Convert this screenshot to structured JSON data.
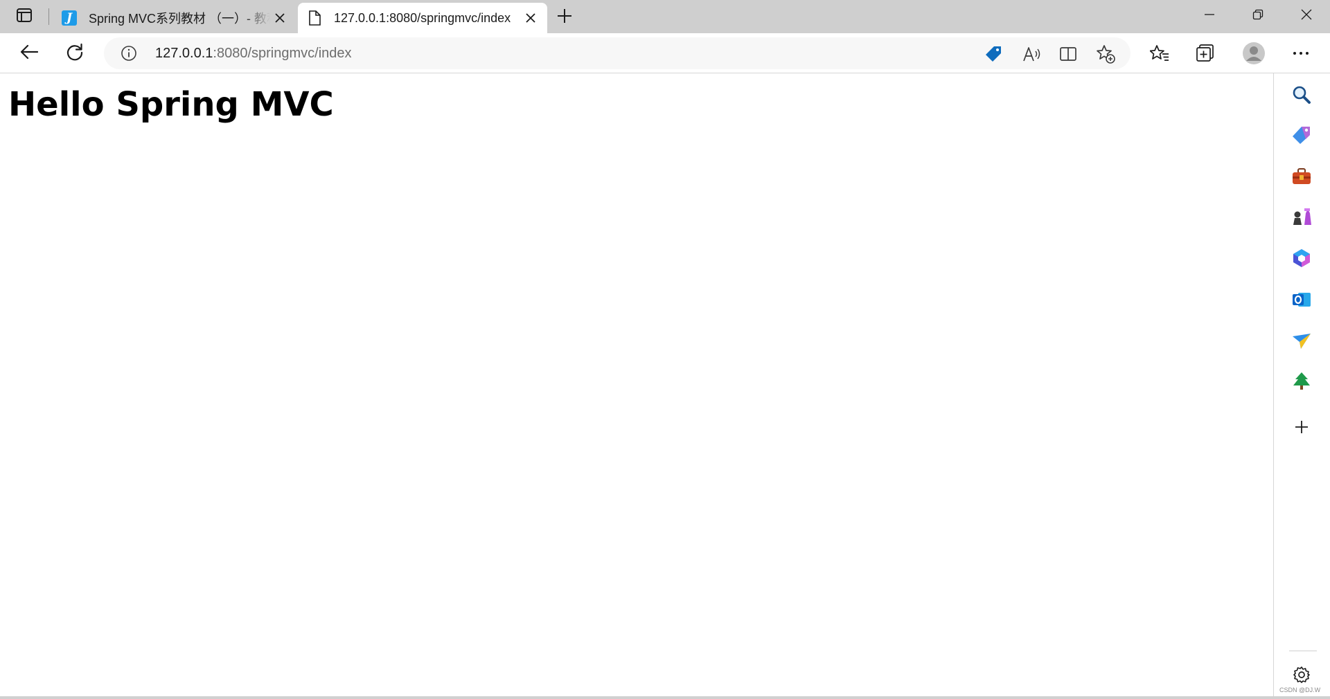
{
  "tabs": [
    {
      "title": "Spring MVC系列教材 （一）- 教程",
      "favicon": "J",
      "active": false
    },
    {
      "title": "127.0.0.1:8080/springmvc/index",
      "favicon": "page-icon",
      "active": true
    }
  ],
  "address": {
    "host": "127.0.0.1",
    "path": ":8080/springmvc/index"
  },
  "page": {
    "heading": "Hello Spring MVC"
  },
  "watermark": "CSDN @DJ.W",
  "icons": {
    "toolbar": [
      "back-icon",
      "reload-icon",
      "info-icon",
      "shopping-tag-icon",
      "read-aloud-icon",
      "split-screen-icon",
      "add-favorite-icon",
      "favorites-icon",
      "collections-icon",
      "profile-icon",
      "more-icon"
    ],
    "sidebar": [
      "search-icon",
      "shopping-icon",
      "tools-icon",
      "games-icon",
      "microsoft365-icon",
      "outlook-icon",
      "send-icon",
      "tree-icon",
      "add-icon",
      "settings-icon"
    ]
  },
  "colors": {
    "accent": "#0f6cbd",
    "tabbar": "#cfcfcf"
  }
}
